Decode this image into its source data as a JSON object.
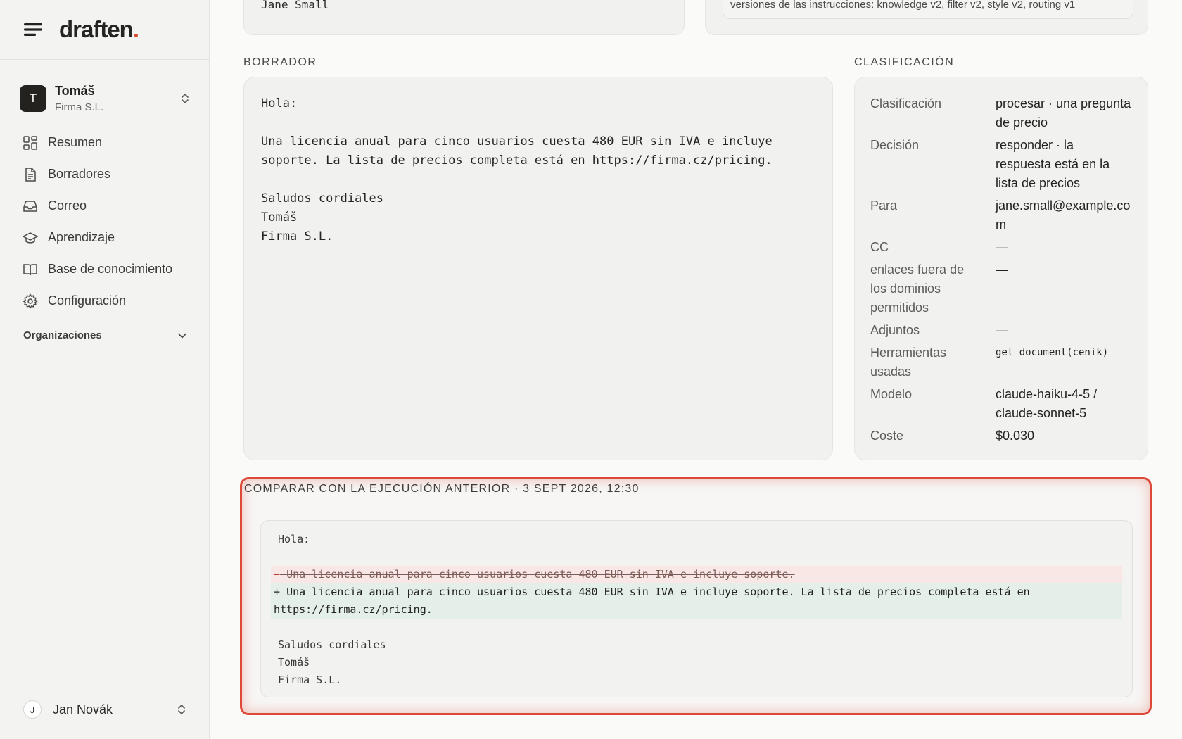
{
  "brand": {
    "name": "draften",
    "dot": "."
  },
  "account": {
    "initial": "T",
    "name": "Tomáš",
    "org": "Firma S.L."
  },
  "nav": {
    "items": [
      {
        "label": "Resumen",
        "icon": "dashboard-icon"
      },
      {
        "label": "Borradores",
        "icon": "document-icon"
      },
      {
        "label": "Correo",
        "icon": "inbox-icon"
      },
      {
        "label": "Aprendizaje",
        "icon": "graduation-cap-icon"
      },
      {
        "label": "Base de conocimiento",
        "icon": "book-icon"
      },
      {
        "label": "Configuración",
        "icon": "gear-icon"
      }
    ],
    "organizations_label": "Organizaciones"
  },
  "user": {
    "initial": "J",
    "name": "Jan Novák"
  },
  "top": {
    "recipient_line": "Jane Small",
    "versions_line": "versiones de las instrucciones: knowledge v2, filter v2, style v2, routing v1"
  },
  "draft": {
    "section_label": "BORRADOR",
    "body": "Hola:\n\nUna licencia anual para cinco usuarios cuesta 480 EUR sin IVA e incluye\nsoporte. La lista de precios completa está en https://firma.cz/pricing.\n\nSaludos cordiales\nTomáš\nFirma S.L."
  },
  "classification": {
    "section_label": "CLASIFICACIÓN",
    "rows": [
      {
        "key": "Clasificación",
        "value": "procesar · una pregunta de precio"
      },
      {
        "key": "Decisión",
        "value": "responder · la respuesta está en la lista de precios"
      },
      {
        "key": "Para",
        "value": "jane.small@example.com"
      },
      {
        "key": "CC",
        "value": "—"
      },
      {
        "key": "enlaces fuera de los dominios permitidos",
        "value": "—"
      },
      {
        "key": "Adjuntos",
        "value": "—"
      },
      {
        "key": "Herramientas usadas",
        "value": "get_document(cenik)"
      },
      {
        "key": "Modelo",
        "value": "claude-haiku-4-5 / claude-sonnet-5"
      },
      {
        "key": "Coste",
        "value": "$0.030"
      }
    ]
  },
  "compare": {
    "label": "COMPARAR CON LA EJECUCIÓN ANTERIOR · 3 SEPT 2026, 12:30",
    "greeting": "Hola:",
    "removed_sign": "−",
    "removed": "Una licencia anual para cinco usuarios cuesta 480 EUR sin IVA e incluye soporte.",
    "added_sign": "+",
    "added": "Una licencia anual para cinco usuarios cuesta 480 EUR sin IVA e incluye soporte. La lista de precios completa está en https://firma.cz/pricing.",
    "closing": "Saludos cordiales",
    "sign_name": "Tomáš",
    "sign_org": "Firma S.L."
  },
  "colors": {
    "accent": "#d9452b",
    "highlight": "#de4a3a",
    "diff_removed": "#f8e7e5",
    "diff_added": "#e3efe8"
  }
}
